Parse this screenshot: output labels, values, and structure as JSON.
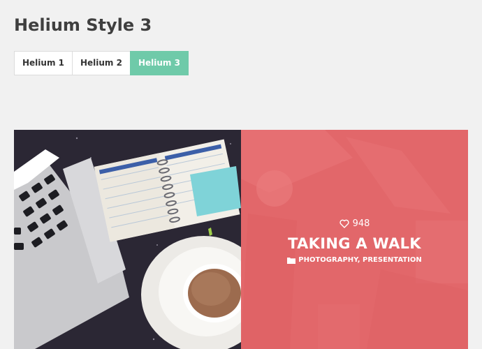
{
  "page": {
    "title": "Helium Style 3"
  },
  "tabs": [
    {
      "label": "Helium 1",
      "active": false
    },
    {
      "label": "Helium 2",
      "active": false
    },
    {
      "label": "Helium 3",
      "active": true
    }
  ],
  "colors": {
    "active_tab": "#6fcaa9",
    "overlay": "#e2676a",
    "background": "#f1f1f1"
  },
  "gallery": {
    "items": [
      {
        "image": "laptop-notebook-coffee-photo"
      },
      {
        "image": "city-street-photo",
        "likes": "948",
        "title": "TAKING A WALK",
        "categories": "PHOTOGRAPHY, PRESENTATION",
        "like_icon": "heart-icon",
        "category_icon": "folder-icon"
      }
    ]
  }
}
